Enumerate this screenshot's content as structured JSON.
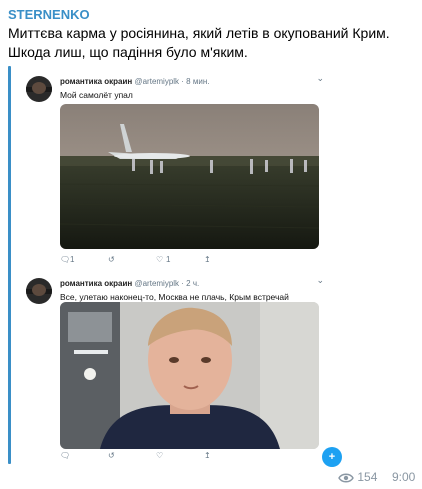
{
  "post": {
    "channel": "STERNENKO",
    "line1": "Миттєва карма у росіянина, який летів в окупований Крим.",
    "line2": "Шкода лиш, що падіння було м'яким.",
    "views": "154",
    "time": "9:00"
  },
  "tweets": [
    {
      "name": "романтика окраин",
      "handle": "@artemiyplk",
      "age": "· 8 мин.",
      "text": "Мой самолёт упал",
      "replies": "1",
      "retweets": "",
      "likes": "1"
    },
    {
      "name": "романтика окраин",
      "handle": "@artemiyplk",
      "age": "· 2 ч.",
      "text": "Все, улетаю наконец-то, Москва не плачь, Крым встречай",
      "replies": "",
      "retweets": "",
      "likes": ""
    }
  ],
  "icons": {
    "reply": "reply-icon",
    "retweet": "retweet-icon",
    "like": "heart-icon",
    "share": "share-icon",
    "views": "eye-icon"
  },
  "colors": {
    "channel": "#3a8fc7",
    "accent": "#1da1f2",
    "muted": "#8a97a3"
  }
}
